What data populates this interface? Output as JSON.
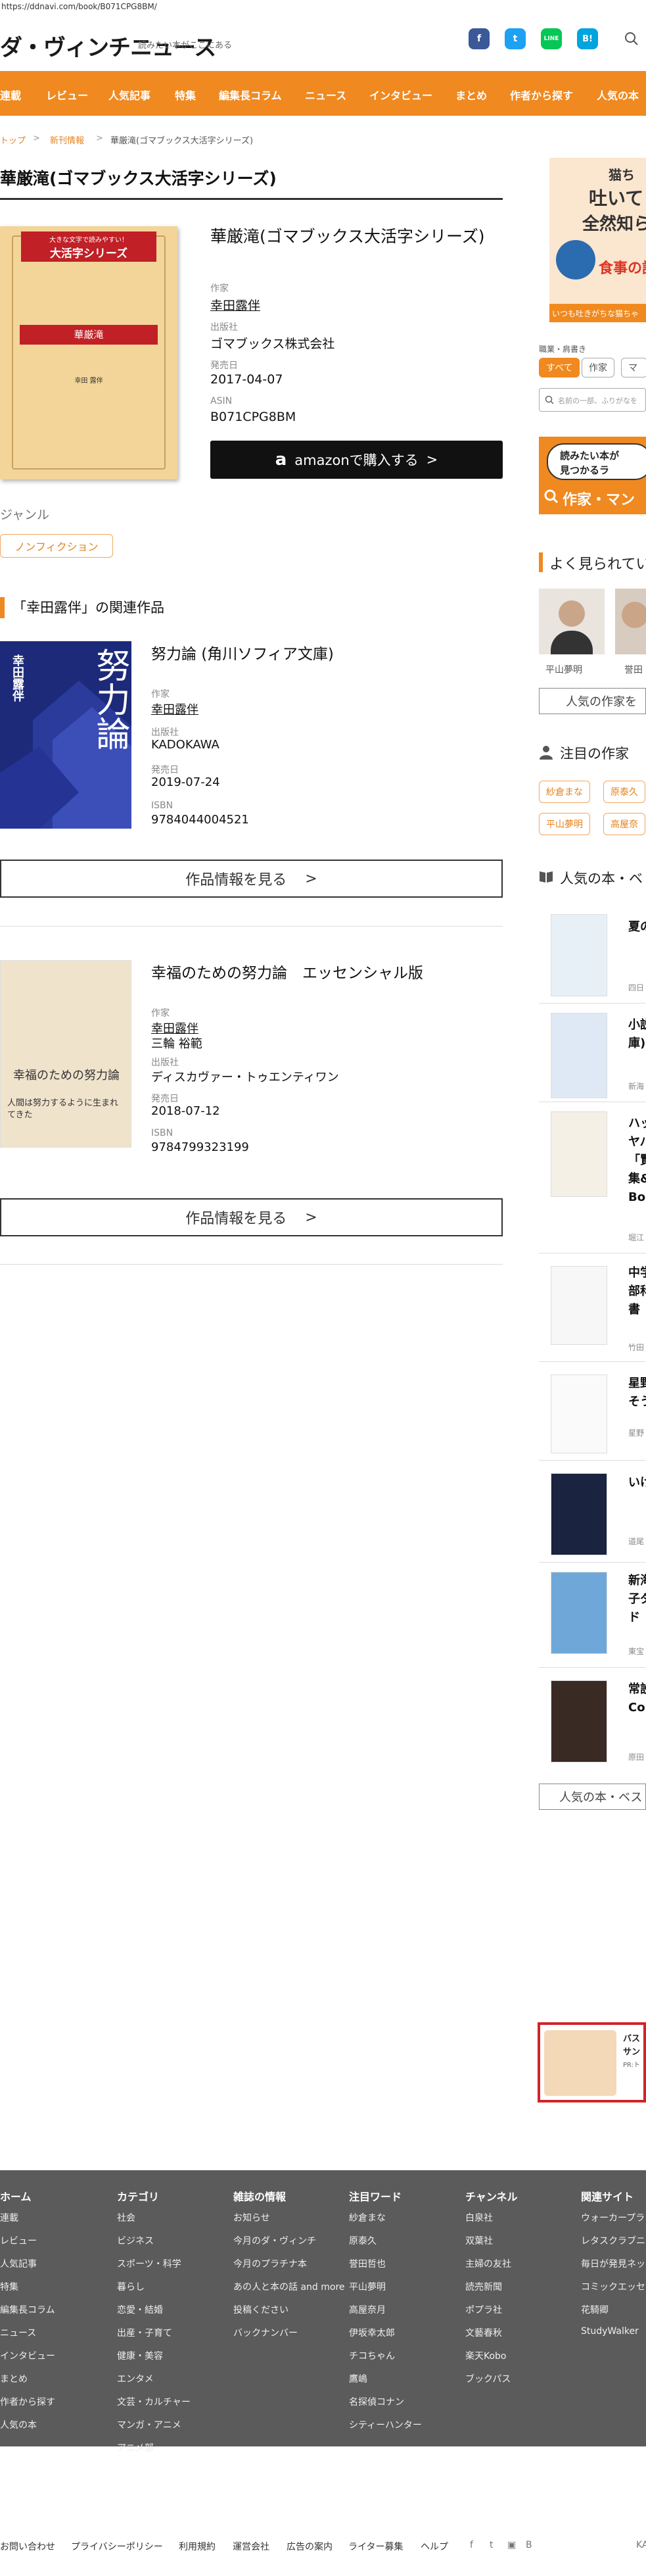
{
  "url": "https://ddnavi.com/book/B071CPG8BM/",
  "header": {
    "logo": "ダ・ヴィンチニュース",
    "tagline": "読みたい本がここにある",
    "social": [
      "f",
      "t",
      "LINE",
      "B!"
    ]
  },
  "nav": [
    "連載",
    "レビュー",
    "人気記事",
    "特集",
    "編集長コラム",
    "ニュース",
    "インタビュー",
    "まとめ",
    "作者から探す",
    "人気の本"
  ],
  "breadcrumb": [
    "トップ",
    "新刊情報",
    "華厳滝(ゴマブックス大活字シリーズ)"
  ],
  "book": {
    "page_title": "華厳滝(ゴマブックス大活字シリーズ)",
    "title": "華厳滝(ゴマブックス大活字シリーズ)",
    "cover": {
      "top_text": "大きな文字で読みやすい！",
      "series": "大活字シリーズ",
      "band": "華厳滝",
      "author": "幸田 露伴"
    },
    "fields": [
      {
        "label": "作家",
        "value": "幸田露伴"
      },
      {
        "label": "出版社",
        "value": "ゴマブックス株式会社"
      },
      {
        "label": "発売日",
        "value": "2017-04-07"
      },
      {
        "label": "ASIN",
        "value": "B071CPG8BM"
      }
    ],
    "amazon_button": "amazonで購入する",
    "genre_label": "ジャンル",
    "genre": "ノンフィクション"
  },
  "related": {
    "heading": "「幸田露伴」の関連作品",
    "more_label": "作品情報を見る",
    "items": [
      {
        "title": "努力論 (角川ソフィア文庫)",
        "cover_title": "努力論",
        "cover_author": "幸田露伴",
        "fields": [
          {
            "label": "作家",
            "value": "幸田露伴"
          },
          {
            "label": "出版社",
            "value": "KADOKAWA"
          },
          {
            "label": "発売日",
            "value": "2019-07-24"
          },
          {
            "label": "ISBN",
            "value": "9784044004521"
          }
        ]
      },
      {
        "title": "幸福のための努力論　エッセンシャル版",
        "cover_title": "幸福のための努力論",
        "cover_sub": "人間は努力するように生まれてきた",
        "fields": [
          {
            "label": "作家",
            "value": "幸田露伴"
          },
          {
            "label": "",
            "value": "三輪 裕範"
          },
          {
            "label": "出版社",
            "value": "ディスカヴァー・トゥエンティワン"
          },
          {
            "label": "発売日",
            "value": "2018-07-12"
          },
          {
            "label": "ISBN",
            "value": "9784799323199"
          }
        ]
      }
    ]
  },
  "sidebar": {
    "ad_top": {
      "line1": "猫ち",
      "line2": "吐いて",
      "line3": "全然知ら",
      "line4": "食事の話",
      "line5": "いつも吐きがちな猫ちゃ"
    },
    "author_search": {
      "label": "職業・肩書き",
      "tabs": [
        "すべて",
        "作家",
        "マ"
      ],
      "placeholder": "名前の一部、ふりがなを"
    },
    "banner": {
      "line1": "読みたい本が",
      "line2": "見つかるラ",
      "cta": "作家・マン"
    },
    "popular_authors": {
      "heading": "よく見られてい",
      "names": [
        "平山夢明",
        "誉田"
      ],
      "button": "人気の作家を"
    },
    "trending": {
      "heading": "注目の作家",
      "chips": [
        "紗倉まな",
        "原泰久",
        "平山夢明",
        "高屋奈"
      ]
    },
    "ranking": {
      "heading": "人気の本・ベ",
      "items": [
        {
          "title": "夏の",
          "author": "四日"
        },
        {
          "title": "小説\n庫)",
          "author": "新海"
        },
        {
          "title": "ハッ\nヤバ\n「賢\n集&\nBoo",
          "author": "堀江"
        },
        {
          "title": "中学\n部科\n書",
          "author": "竹田"
        },
        {
          "title": "星野\nそう",
          "author": "星野"
        },
        {
          "title": "いけ",
          "author": "道尾"
        },
        {
          "title": "新海\n子ダ\nド",
          "author": "東宝"
        },
        {
          "title": "常設\nCol",
          "author": "原田"
        }
      ],
      "button": "人気の本・ベス"
    },
    "ad_bottom": {
      "line1": "バス",
      "line2": "サン",
      "line3": "PR:ト"
    }
  },
  "footer": {
    "columns": [
      {
        "heading": "ホーム",
        "items": [
          "連載",
          "レビュー",
          "人気記事",
          "特集",
          "編集長コラム",
          "ニュース",
          "インタビュー",
          "まとめ",
          "作者から探す",
          "人気の本"
        ]
      },
      {
        "heading": "カテゴリ",
        "items": [
          "社会",
          "ビジネス",
          "スポーツ・科学",
          "暮らし",
          "恋愛・結婚",
          "出産・子育て",
          "健康・美容",
          "エンタメ",
          "文芸・カルチャー",
          "マンガ・アニメ",
          "アニメ部"
        ]
      },
      {
        "heading": "雑誌の情報",
        "items": [
          "お知らせ",
          "今月のダ・ヴィンチ",
          "今月のプラチナ本",
          "あの人と本の話 and more",
          "投稿ください",
          "バックナンバー"
        ]
      },
      {
        "heading": "注目ワード",
        "items": [
          "紗倉まな",
          "原泰久",
          "誉田哲也",
          "平山夢明",
          "高屋奈月",
          "伊坂幸太郎",
          "チコちゃん",
          "鷹嶋",
          "名探偵コナン",
          "シティーハンター"
        ]
      },
      {
        "heading": "チャンネル",
        "items": [
          "白泉社",
          "双葉社",
          "主婦の友社",
          "読売新聞",
          "ポプラ社",
          "文藝春秋",
          "楽天Kobo",
          "ブックパス"
        ]
      },
      {
        "heading": "関連サイト",
        "items": [
          "ウォーカープラ",
          "レタスクラブニ",
          "毎日が発見ネッ",
          "コミックエッセ",
          "花騎卿",
          "StudyWalker"
        ]
      }
    ],
    "bottom_links": [
      "お問い合わせ",
      "プライバシーポリシー",
      "利用規約",
      "運営会社",
      "広告の案内",
      "ライター募集",
      "ヘルプ"
    ],
    "bottom_right": "KA"
  }
}
